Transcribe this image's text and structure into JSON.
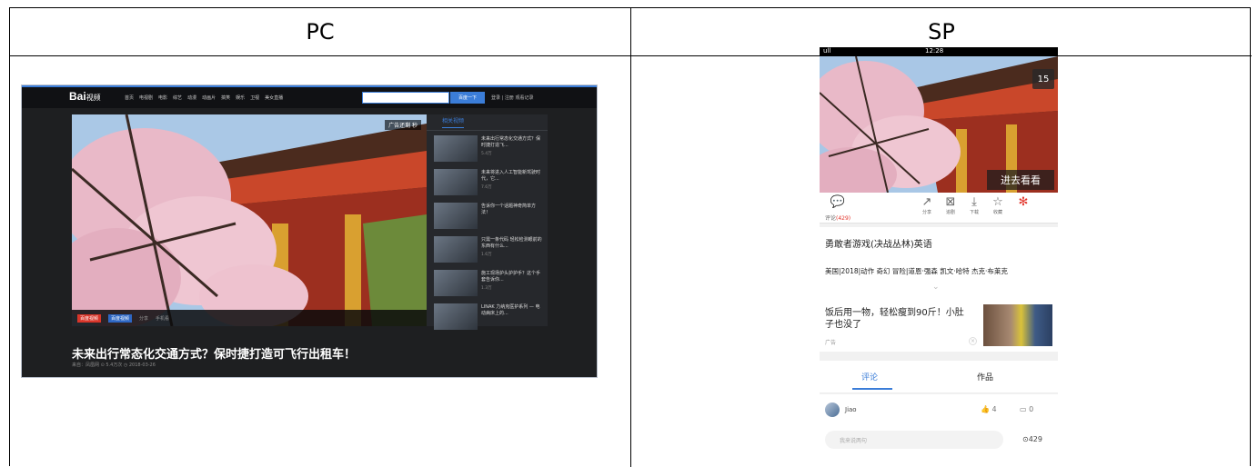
{
  "table": {
    "headers": [
      "PC",
      "SP"
    ]
  },
  "pc": {
    "logo": "Bai",
    "logo_sub": "视频",
    "nav": [
      "首页",
      "电视剧",
      "电影",
      "综艺",
      "动漫",
      "动画片",
      "搞笑",
      "娱乐",
      "卫视",
      "美女直播"
    ],
    "search_button": "百度一下",
    "user_links": "登录 | 注册  观看记录",
    "ad_countdown": "广告还剩 秒",
    "control": {
      "badge": "百度视频",
      "badge2": "百度视频",
      "share": "分享",
      "phone": "手机看"
    },
    "side_tab": "相关视频",
    "related": [
      {
        "title": "未来出行常态化交通方式？保时捷打造飞...",
        "meta": "5.4万"
      },
      {
        "title": "未来将进入人工智能新驾驶时代，它...",
        "meta": "7.6万"
      },
      {
        "title": "告诉你一个话题神奇简单方法！",
        "meta": ""
      },
      {
        "title": "只需一条代码 轻松检测眼前的东西有什么...",
        "meta": "1.6万"
      },
      {
        "title": "施工现场护头护护手？这个手套告诉你...",
        "meta": "1.3万"
      },
      {
        "title": "LINAK 力纳克医护系列 — 电动病床上的...",
        "meta": ""
      }
    ],
    "video_title": "未来出行常态化交通方式？保时捷打造可飞行出租车！",
    "video_meta": "来自：凤凰网  ⊙ 5.4万次  ◷ 2018-03-26"
  },
  "sp": {
    "status_time": "12:28",
    "status_signal": "ull",
    "ad_count": "15",
    "enter_label": "进去看看",
    "comment_label": "评论",
    "comment_count": "(429)",
    "actions": [
      "分享",
      "追剧",
      "下载",
      "收藏"
    ],
    "show_title": "勇敢者游戏(决战丛林)英语",
    "show_meta": "美国|2018|动作 奇幻 冒险|道恩·强森 凯文·哈特 杰克·布莱克",
    "ad_text": "饭后用一物，轻松瘦到90斤！小肚子也没了",
    "ad_tag": "广告",
    "tab_comments": "评论",
    "tab_works": "作品",
    "user": "Jiao",
    "likes": "4",
    "replies": "0",
    "input_placeholder": "我来说两句",
    "total_comments": "429"
  },
  "colors": {
    "accent": "#3b7dd8",
    "red": "#e2342a"
  }
}
